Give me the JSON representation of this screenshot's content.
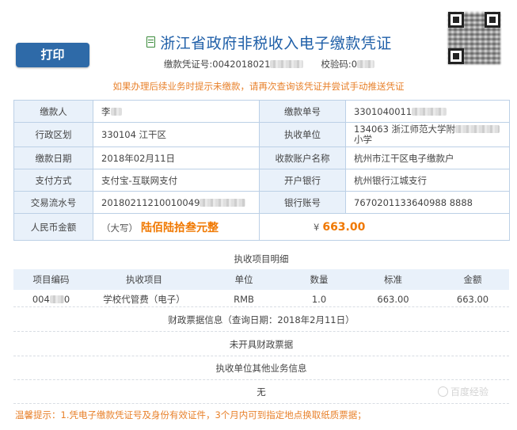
{
  "print_button": "打印",
  "title": "浙江省政府非税收入电子缴款凭证",
  "voucher_no_label": "缴款凭证号:",
  "voucher_no_value": "0042018021",
  "check_code_label": "校验码:",
  "check_code_value": "0",
  "warning": "如果办理后续业务时提示未缴款，请再次查询该凭证并尝试手动推送凭证",
  "info": {
    "payer_label": "缴款人",
    "payer_value": "李",
    "payment_no_label": "缴款单号",
    "payment_no_value": "3301040011",
    "region_label": "行政区划",
    "region_value": "330104  江干区",
    "collector_label": "执收单位",
    "collector_value_1": "134063  浙江师范大学附",
    "collector_value_2": "小学",
    "date_label": "缴款日期",
    "date_value": "2018年02月11日",
    "account_name_label": "收款账户名称",
    "account_name_value": "杭州市江干区电子缴款户",
    "pay_method_label": "支付方式",
    "pay_method_value": "支付宝-互联网支付",
    "bank_label": "开户银行",
    "bank_value": "杭州银行江城支行",
    "txn_label": "交易流水号",
    "txn_value": "20180211210010049",
    "bank_account_label": "银行账号",
    "bank_account_value": "7670201133640988 8888",
    "amount_label": "人民币金额",
    "amount_cap_prefix": "（大写）",
    "amount_cn": "陆佰陆拾叁元整",
    "yen": "¥",
    "amount_num": "663.00"
  },
  "items_title": "执收项目明细",
  "items_headers": [
    "项目编码",
    "执收项目",
    "单位",
    "数量",
    "标准",
    "金额"
  ],
  "items_rows": [
    [
      "004",
      "学校代管费（电子）",
      "RMB",
      "1.0",
      "663.00",
      "663.00"
    ]
  ],
  "item_code_suffix": "0",
  "bill_info": "财政票据信息（查询日期：2018年2月11日）",
  "bill_status": "未开具财政票据",
  "other_info_title": "执收单位其他业务信息",
  "other_info_value": "无",
  "footer_note": "温馨提示：1.凭电子缴款凭证号及身份有效证件，3个月内可到指定地点换取纸质票据；",
  "watermark": "百度经验"
}
